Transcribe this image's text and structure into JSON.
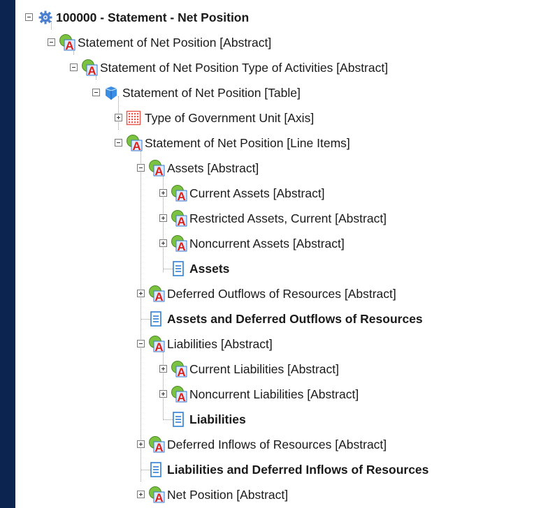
{
  "tree": {
    "root": {
      "label": "100000 - Statement - Net Position",
      "icon": "gear-icon"
    },
    "items": [
      {
        "label": "Statement of Net Position [Abstract]",
        "icon": "abstract-icon",
        "toggle": "expanded"
      },
      {
        "label": "Statement of Net Position Type of Activities [Abstract]",
        "icon": "abstract-icon",
        "toggle": "expanded"
      },
      {
        "label": "Statement of Net Position [Table]",
        "icon": "table-icon",
        "toggle": "expanded"
      },
      {
        "label": "Type of Government Unit [Axis]",
        "icon": "axis-icon",
        "toggle": "collapsed"
      },
      {
        "label": "Statement of Net Position [Line Items]",
        "icon": "abstract-icon",
        "toggle": "expanded"
      },
      {
        "label": "Assets [Abstract]",
        "icon": "abstract-icon",
        "toggle": "expanded"
      },
      {
        "label": "Current Assets [Abstract]",
        "icon": "abstract-icon",
        "toggle": "collapsed"
      },
      {
        "label": "Restricted Assets, Current [Abstract]",
        "icon": "abstract-icon",
        "toggle": "collapsed"
      },
      {
        "label": "Noncurrent Assets [Abstract]",
        "icon": "abstract-icon",
        "toggle": "collapsed"
      },
      {
        "label": "Assets",
        "icon": "document-icon",
        "toggle": "none"
      },
      {
        "label": "Deferred Outflows of Resources [Abstract]",
        "icon": "abstract-icon",
        "toggle": "collapsed"
      },
      {
        "label": "Assets and Deferred Outflows of Resources",
        "icon": "document-icon",
        "toggle": "none"
      },
      {
        "label": "Liabilities [Abstract]",
        "icon": "abstract-icon",
        "toggle": "expanded"
      },
      {
        "label": "Current Liabilities [Abstract]",
        "icon": "abstract-icon",
        "toggle": "collapsed"
      },
      {
        "label": "Noncurrent Liabilities [Abstract]",
        "icon": "abstract-icon",
        "toggle": "collapsed"
      },
      {
        "label": "Liabilities",
        "icon": "document-icon",
        "toggle": "none"
      },
      {
        "label": "Deferred Inflows of Resources [Abstract]",
        "icon": "abstract-icon",
        "toggle": "collapsed"
      },
      {
        "label": "Liabilities and Deferred Inflows of Resources",
        "icon": "document-icon",
        "toggle": "none"
      },
      {
        "label": "Net Position [Abstract]",
        "icon": "abstract-icon",
        "toggle": "collapsed"
      }
    ]
  },
  "colors": {
    "frame": "#0b2550",
    "abstract_circle": "#7cc242",
    "abstract_letter": "#e0201b",
    "document": "#2f7fd3",
    "table": "#3a8ee6",
    "axis": "#e8554a",
    "gear": "#4a7fd0"
  }
}
